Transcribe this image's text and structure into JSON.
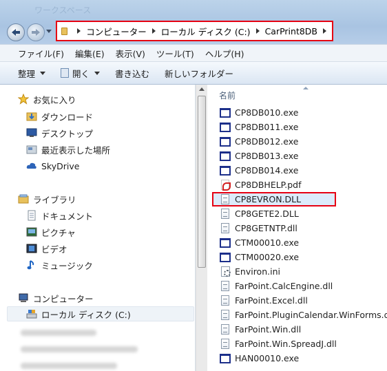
{
  "window": {
    "title": "ワークスペース"
  },
  "address_bar": {
    "crumbs": [
      "コンピューター",
      "ローカル ディスク (C:)",
      "CarPrint8DB"
    ]
  },
  "menu": [
    "ファイル(F)",
    "編集(E)",
    "表示(V)",
    "ツール(T)",
    "ヘルプ(H)"
  ],
  "toolbar": {
    "organize": "整理",
    "open": "開く",
    "burn": "書き込む",
    "new_folder": "新しいフォルダー"
  },
  "nav": {
    "favorites": {
      "label": "お気に入り",
      "items": [
        "ダウンロード",
        "デスクトップ",
        "最近表示した場所",
        "SkyDrive"
      ]
    },
    "libraries": {
      "label": "ライブラリ",
      "items": [
        "ドキュメント",
        "ピクチャ",
        "ビデオ",
        "ミュージック"
      ]
    },
    "computer": {
      "label": "コンピューター",
      "items": [
        "ローカル ディスク (C:)"
      ]
    }
  },
  "file_list": {
    "column_name": "名前",
    "files": [
      {
        "name": "CP8DB010.exe",
        "type": "exe"
      },
      {
        "name": "CP8DB011.exe",
        "type": "exe"
      },
      {
        "name": "CP8DB012.exe",
        "type": "exe"
      },
      {
        "name": "CP8DB013.exe",
        "type": "exe"
      },
      {
        "name": "CP8DB014.exe",
        "type": "exe"
      },
      {
        "name": "CP8DBHELP.pdf",
        "type": "pdf"
      },
      {
        "name": "CP8EVRON.DLL",
        "type": "dll",
        "highlighted": true
      },
      {
        "name": "CP8GETE2.DLL",
        "type": "dll"
      },
      {
        "name": "CP8GETNTP.dll",
        "type": "dll"
      },
      {
        "name": "CTM00010.exe",
        "type": "exe"
      },
      {
        "name": "CTM00020.exe",
        "type": "exe"
      },
      {
        "name": "Environ.ini",
        "type": "ini"
      },
      {
        "name": "FarPoint.CalcEngine.dll",
        "type": "dll"
      },
      {
        "name": "FarPoint.Excel.dll",
        "type": "dll"
      },
      {
        "name": "FarPoint.PluginCalendar.WinForms.dll",
        "type": "dll"
      },
      {
        "name": "FarPoint.Win.dll",
        "type": "dll"
      },
      {
        "name": "FarPoint.Win.SpreadJ.dll",
        "type": "dll"
      },
      {
        "name": "HAN00010.exe",
        "type": "exe"
      }
    ]
  },
  "colors": {
    "highlight_border": "#e60012",
    "selection_fill": "#dcebfb"
  }
}
